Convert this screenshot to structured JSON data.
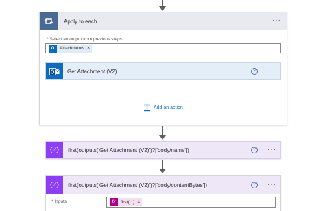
{
  "apply_to_each": {
    "title": "Apply to each",
    "select_label": "* Select an output from previous steps",
    "token_label": "Attachments",
    "token_remove": "×",
    "more": "···"
  },
  "get_attachment": {
    "title": "Get Attachment (V2)",
    "help": "?",
    "more": "···"
  },
  "add_action": {
    "label": "Add an action"
  },
  "compose_name": {
    "title": "first(outputs('Get Attachment (V2)')?['body/name'])",
    "help": "?",
    "more": "···"
  },
  "compose_content": {
    "title": "first(outputs('Get Attachment (V2)')?['body/contentBytes'])",
    "help": "?",
    "more": "···",
    "inputs_label": "* Inputs",
    "token_label": "first(...)",
    "token_icon": "fx",
    "token_remove": "×"
  },
  "colors": {
    "loop_header": "#e8eaf0",
    "loop_icon": "#486991",
    "outlook_header": "#e4eef8",
    "outlook_icon": "#0f6cbd",
    "compose_header": "#ede7f7",
    "compose_icon": "#8c3ef5",
    "fx_token": "#ad008c"
  }
}
